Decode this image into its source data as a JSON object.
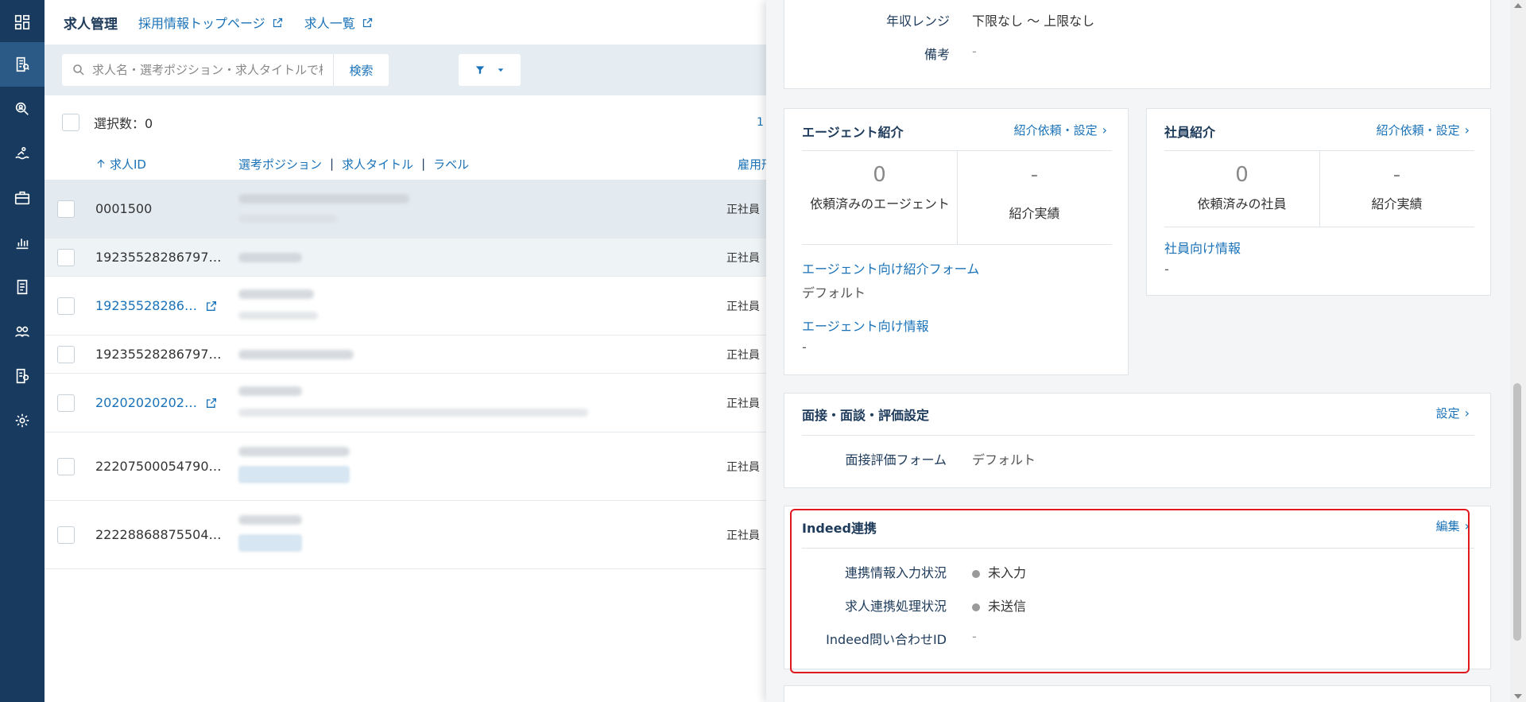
{
  "nav": {
    "icons": [
      "dashboard-icon",
      "job-list-icon",
      "candidate-search-icon",
      "pool-icon",
      "briefcase-icon",
      "chart-icon",
      "document-icon",
      "users-icon",
      "export-icon",
      "gear-icon"
    ],
    "active_index": 1
  },
  "header": {
    "title": "求人管理",
    "links": [
      "採用情報トップページ",
      "求人一覧"
    ]
  },
  "search": {
    "placeholder": "求人名・選考ポジション・求人タイトルで検索",
    "button": "検索"
  },
  "selection": {
    "label": "選択数：0",
    "pager_start": "1"
  },
  "table": {
    "columns": {
      "id": "求人ID",
      "position": "選考ポジション",
      "title": "求人タイトル",
      "label": "ラベル",
      "employment": "雇用形"
    },
    "rows": [
      {
        "id": "0001500",
        "link": false,
        "employment": "正社員"
      },
      {
        "id": "19235528286797…",
        "link": false,
        "employment": "正社員"
      },
      {
        "id": "19235528286…",
        "link": true,
        "employment": "正社員"
      },
      {
        "id": "19235528286797…",
        "link": false,
        "employment": "正社員"
      },
      {
        "id": "20202020202…",
        "link": true,
        "employment": "正社員"
      },
      {
        "id": "22207500054790…",
        "link": false,
        "employment": "正社員"
      },
      {
        "id": "22228868875504…",
        "link": false,
        "employment": "正社員"
      }
    ]
  },
  "panel": {
    "salary": {
      "label": "年収レンジ",
      "value": "下限なし ～ 上限なし"
    },
    "remarks": {
      "label": "備考",
      "value": "-"
    },
    "agent": {
      "title": "エージェント紹介",
      "action": "紹介依頼・設定",
      "stat1_num": "0",
      "stat1_label": "依頼済みのエージェント",
      "stat2_num": "-",
      "stat2_label": "紹介実績",
      "form_link": "エージェント向け紹介フォーム",
      "form_value": "デフォルト",
      "info_link": "エージェント向け情報",
      "info_value": "-"
    },
    "employee": {
      "title": "社員紹介",
      "action": "紹介依頼・設定",
      "stat1_num": "0",
      "stat1_label": "依頼済みの社員",
      "stat2_num": "-",
      "stat2_label": "紹介実績",
      "info_link": "社員向け情報",
      "info_value": "-"
    },
    "interview": {
      "title": "面接・面談・評価設定",
      "action": "設定",
      "form_label": "面接評価フォーム",
      "form_value": "デフォルト"
    },
    "indeed": {
      "title": "Indeed連携",
      "action": "編集",
      "input_status_label": "連携情報入力状況",
      "input_status_value": "未入力",
      "process_status_label": "求人連携処理状況",
      "process_status_value": "未送信",
      "inquiry_label": "Indeed問い合わせID",
      "inquiry_value": "-"
    }
  }
}
